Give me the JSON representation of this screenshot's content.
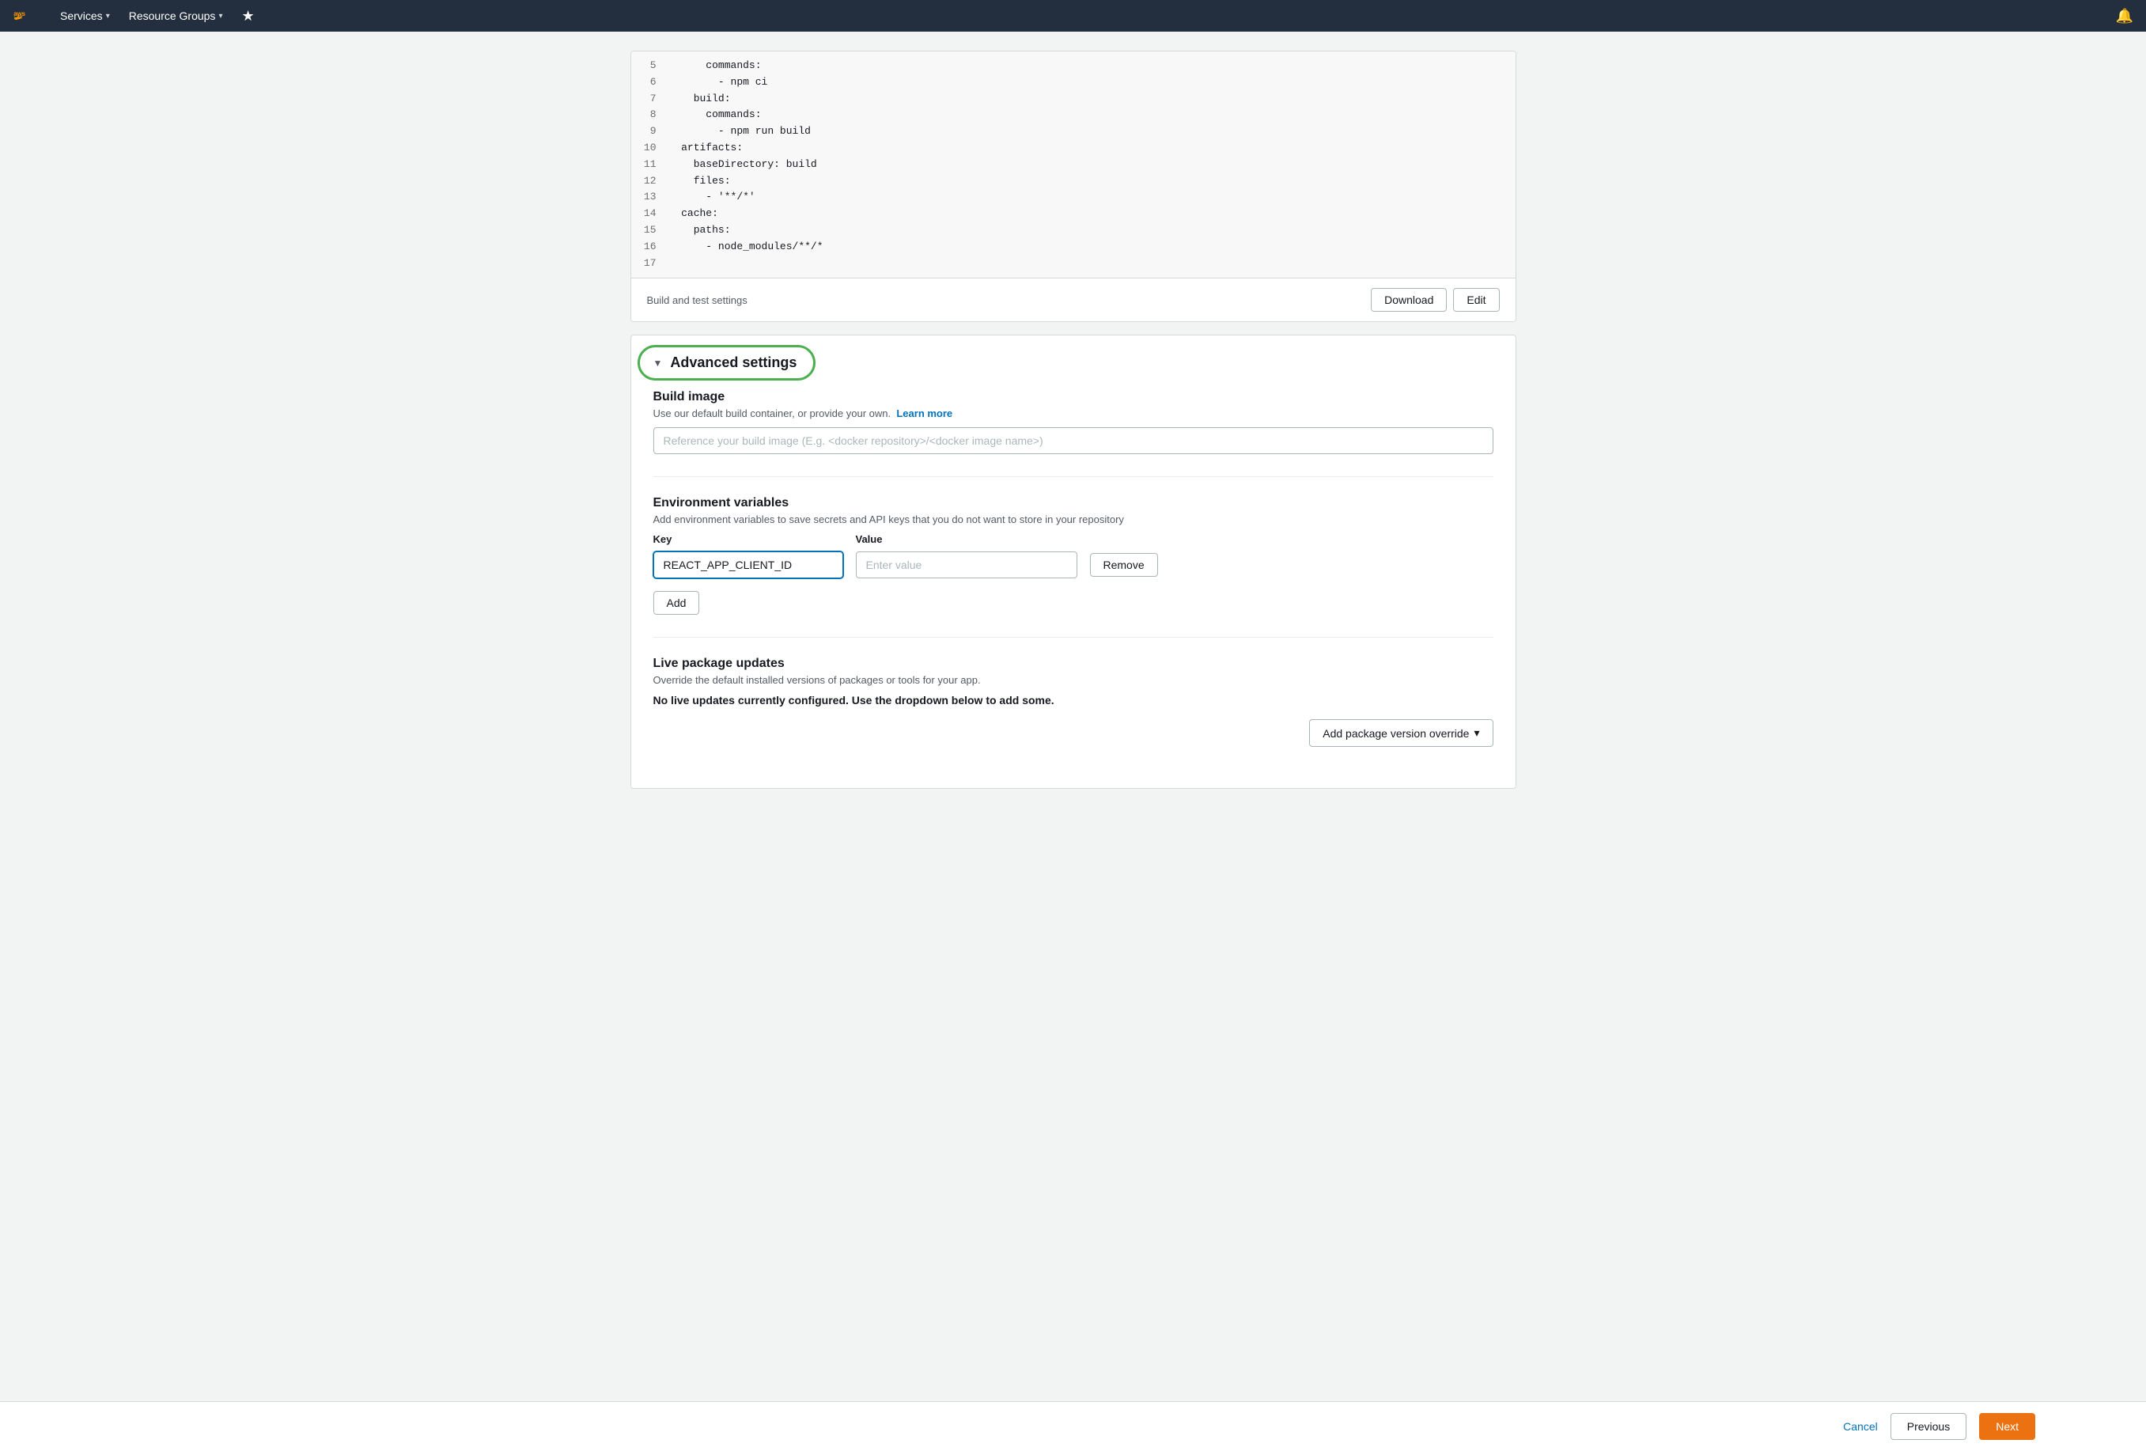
{
  "navbar": {
    "services_label": "Services",
    "resource_groups_label": "Resource Groups",
    "chevron": "▾",
    "pin_icon": "★",
    "bell_icon": "🔔"
  },
  "code": {
    "lines": [
      {
        "num": "5",
        "content": "      commands:"
      },
      {
        "num": "6",
        "content": "        - npm ci"
      },
      {
        "num": "7",
        "content": "    build:"
      },
      {
        "num": "8",
        "content": "      commands:"
      },
      {
        "num": "9",
        "content": "        - npm run build"
      },
      {
        "num": "10",
        "content": "  artifacts:"
      },
      {
        "num": "11",
        "content": "    baseDirectory: build"
      },
      {
        "num": "12",
        "content": "    files:"
      },
      {
        "num": "13",
        "content": "      - '**/*'"
      },
      {
        "num": "14",
        "content": "  cache:"
      },
      {
        "num": "15",
        "content": "    paths:"
      },
      {
        "num": "16",
        "content": "      - node_modules/**/*"
      },
      {
        "num": "17",
        "content": ""
      }
    ]
  },
  "build_settings": {
    "label": "Build and test settings",
    "download_btn": "Download",
    "edit_btn": "Edit"
  },
  "advanced_settings": {
    "title": "Advanced settings",
    "build_image": {
      "section_title": "Build image",
      "description": "Use our default build container, or provide your own.",
      "learn_more_link": "Learn more",
      "input_placeholder": "Reference your build image (E.g. <docker repository>/<docker image name>)"
    },
    "env_variables": {
      "section_title": "Environment variables",
      "description": "Add environment variables to save secrets and API keys that you do not want to store in your repository",
      "key_label": "Key",
      "value_label": "Value",
      "rows": [
        {
          "key": "REACT_APP_CLIENT_ID",
          "value": ""
        }
      ],
      "value_placeholder": "Enter value",
      "remove_btn": "Remove",
      "add_btn": "Add"
    },
    "live_package_updates": {
      "section_title": "Live package updates",
      "description": "Override the default installed versions of packages or tools for your app.",
      "no_updates_text": "No live updates currently configured. Use the dropdown below to add some.",
      "add_package_btn": "Add package version override",
      "dropdown_icon": "▾"
    }
  },
  "footer": {
    "cancel_label": "Cancel",
    "previous_label": "Previous",
    "next_label": "Next"
  }
}
